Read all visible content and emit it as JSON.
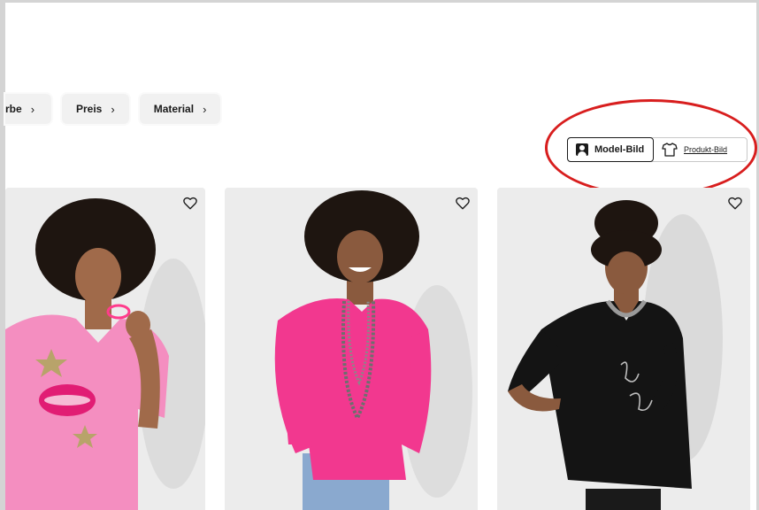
{
  "filters": [
    {
      "label": "rbe",
      "chevron": "›"
    },
    {
      "label": "Preis",
      "chevron": "›"
    },
    {
      "label": "Material",
      "chevron": "›"
    }
  ],
  "view_toggle": {
    "model_label": "Model-Bild",
    "product_label": "Produkt-Bild",
    "active": "Model-Bild"
  },
  "colors": {
    "annotation": "#d81e1e",
    "shirt_pink_light": "#f48ec0",
    "shirt_pink_bright": "#f2388f",
    "shirt_black": "#141414"
  },
  "products": [
    {
      "icon": "heart-icon",
      "shirt_color": "#f48ec0"
    },
    {
      "icon": "heart-icon",
      "shirt_color": "#f2388f"
    },
    {
      "icon": "heart-icon",
      "shirt_color": "#141414"
    }
  ]
}
